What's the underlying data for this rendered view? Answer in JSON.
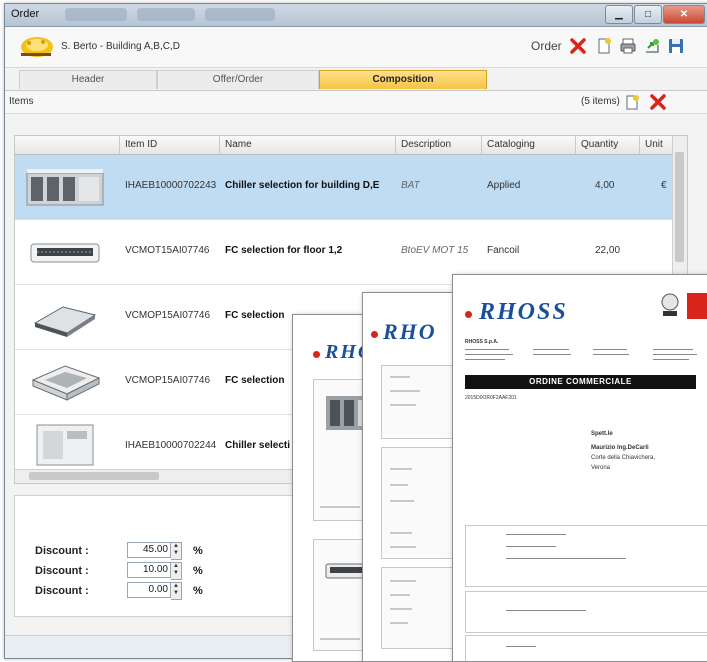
{
  "window": {
    "title": "Order"
  },
  "header": {
    "org": "S. Berto - Building A,B,C,D",
    "order_label": "Order"
  },
  "tabs": [
    {
      "label": "Header"
    },
    {
      "label": "Offer/Order"
    },
    {
      "label": "Composition"
    }
  ],
  "items": {
    "label": "Items",
    "count": "(5 items)"
  },
  "columns": [
    "Item ID",
    "Name",
    "Description",
    "Cataloging",
    "Quantity",
    "Unit"
  ],
  "rows": [
    {
      "id": "IHAEB10000702243",
      "name": "Chiller selection for building D,E",
      "desc": "BAT",
      "cat": "Applied",
      "qty": "4,00",
      "unit": "€",
      "selected": true
    },
    {
      "id": "VCMOT15AI07746",
      "name": "FC selection for floor 1,2",
      "desc": "BtoEV MOT 15",
      "cat": "Fancoil",
      "qty": "22,00",
      "unit": ""
    },
    {
      "id": "VCMOP15AI07746",
      "name": "FC selection",
      "desc": "",
      "cat": "",
      "qty": "",
      "unit": ""
    },
    {
      "id": "VCMOP15AI07746",
      "name": "FC selection",
      "desc": "",
      "cat": "",
      "qty": "",
      "unit": ""
    },
    {
      "id": "IHAEB10000702244",
      "name": "Chiller selecti",
      "desc": "",
      "cat": "",
      "qty": "",
      "unit": ""
    }
  ],
  "discounts": [
    {
      "label": "Discount :",
      "value": "45.00",
      "unit": "%"
    },
    {
      "label": "Discount :",
      "value": "10.00",
      "unit": "%"
    },
    {
      "label": "Discount :",
      "value": "0.00",
      "unit": "%"
    }
  ],
  "docs": {
    "brand": "RHOSS",
    "brand_short": "RHO",
    "company": "RHOSS S.p.A.",
    "heading": "ORDINE COMMERCIALE",
    "recipient1": "Spett.le",
    "recipient2": "Maurizio Ing.DeCarli",
    "recipient3": "Corte della Chiavichera,",
    "recipient4": "Verona",
    "ref": "2015D0OR0F2AAF201"
  },
  "colors": {
    "accent": "#f6c445",
    "selection": "#bfdcf2",
    "delete": "#d9241b",
    "brand": "#1c4f9a"
  }
}
